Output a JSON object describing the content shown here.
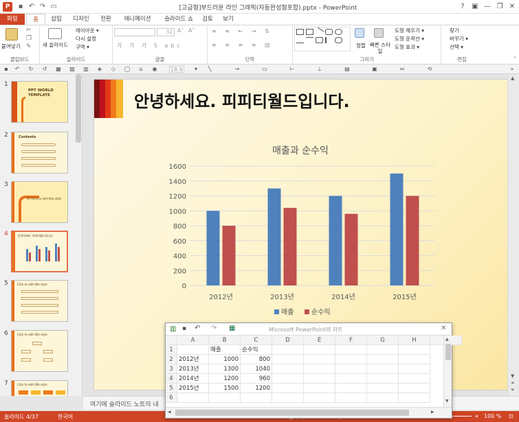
{
  "window": {
    "title": "[고급형]부드러운 라인 그래픽(자동완성형포함).pptx - PowerPoint",
    "controls": [
      "?",
      "▣",
      "—",
      "❐",
      "✕"
    ]
  },
  "tabs": [
    {
      "label": "파일"
    },
    {
      "label": "홈"
    },
    {
      "label": "삽입"
    },
    {
      "label": "디자인"
    },
    {
      "label": "전환"
    },
    {
      "label": "애니메이션"
    },
    {
      "label": "슬라이드 쇼"
    },
    {
      "label": "검토"
    },
    {
      "label": "보기"
    }
  ],
  "ribbon": {
    "clipboard": {
      "label": "클립보드",
      "paste": "붙여넣기"
    },
    "slides": {
      "label": "슬라이드",
      "new_slide": "새 슬라이드",
      "layout": "레이아웃 ▾",
      "reset": "다시 설정",
      "section": "구역 ▾"
    },
    "font": {
      "label": "글꼴",
      "size": "32"
    },
    "paragraph": {
      "label": "단락"
    },
    "drawing": {
      "label": "그리기",
      "arrange": "정렬",
      "quick_styles": "빠른 스타일",
      "fill": "도형 채우기 ▾",
      "outline": "도형 윤곽선 ▾",
      "effects": "도형 효과 ▾"
    },
    "editing": {
      "label": "편집",
      "find": "찾기",
      "replace": "바꾸기 ▾",
      "select": "선택 ▾"
    }
  },
  "quick_toolbar": {
    "font_size": "18.6"
  },
  "thumbnails": [
    {
      "num": "1",
      "lines": [
        "PPT WORLD",
        "TEMPLATE"
      ]
    },
    {
      "num": "2",
      "lines": [
        "Contents"
      ]
    },
    {
      "num": "3",
      "lines": [
        "01.Click to edit title style"
      ]
    },
    {
      "num": "4",
      "lines": [
        "안녕하세요. 피피티월드입니다."
      ]
    },
    {
      "num": "5",
      "lines": [
        "Click to edit title style"
      ]
    },
    {
      "num": "6",
      "lines": [
        "Click to edit title style"
      ]
    },
    {
      "num": "7",
      "lines": [
        "Click to edit title style"
      ]
    }
  ],
  "slide": {
    "title": "안녕하세요. 피피티월드입니다.",
    "band_colors": [
      "#7a1010",
      "#c0121e",
      "#e23a16",
      "#f07a1c",
      "#f6b62e"
    ]
  },
  "chart_data": {
    "type": "bar",
    "title": "매출과 순수익",
    "categories": [
      "2012년",
      "2013년",
      "2014년",
      "2015년"
    ],
    "series": [
      {
        "name": "매출",
        "values": [
          1000,
          1300,
          1200,
          1500
        ],
        "color": "#4f81bd"
      },
      {
        "name": "순수익",
        "values": [
          800,
          1040,
          960,
          1200
        ],
        "color": "#c0504d"
      }
    ],
    "ylim": [
      0,
      1600
    ],
    "yticks": [
      0,
      200,
      400,
      600,
      800,
      1000,
      1200,
      1400,
      1600
    ],
    "grid": true,
    "legend": "bottom"
  },
  "notes": {
    "placeholder": "여기에 슬라이드 노트의 내"
  },
  "datasheet": {
    "title": "Microsoft PowerPoint의 차트",
    "columns": [
      "A",
      "B",
      "C",
      "D",
      "E",
      "F",
      "G",
      "H",
      "I"
    ],
    "rows": [
      [
        "1",
        "",
        "매출",
        "순수익"
      ],
      [
        "2",
        "2012년",
        "1000",
        "800"
      ],
      [
        "3",
        "2013년",
        "1300",
        "1040"
      ],
      [
        "4",
        "2014년",
        "1200",
        "960"
      ],
      [
        "5",
        "2015년",
        "1500",
        "1200"
      ],
      [
        "6",
        "",
        "",
        ""
      ]
    ]
  },
  "status": {
    "slide": "슬라이드 4/37",
    "language": "한국어",
    "notes_btn": "슬라이드 노트",
    "comments_btn": "메모",
    "zoom": "100 %"
  }
}
